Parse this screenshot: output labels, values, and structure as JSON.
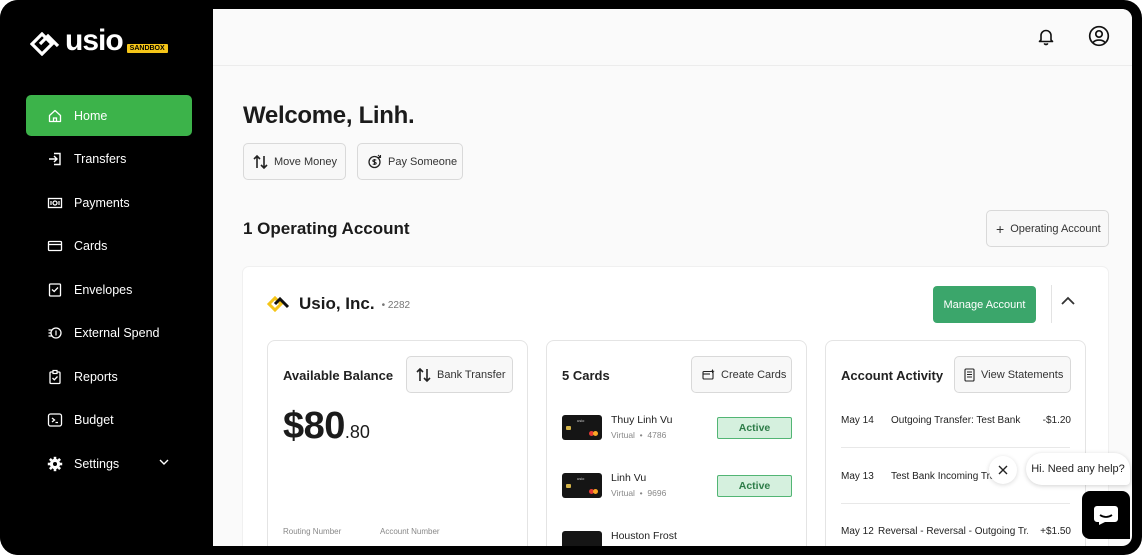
{
  "brand": {
    "name": "usio",
    "env_badge": "SANDBOX",
    "accent": "#3cb34a"
  },
  "sidebar": {
    "items": [
      {
        "label": "Home",
        "icon": "home-icon",
        "active": true
      },
      {
        "label": "Transfers",
        "icon": "transfer-in-icon",
        "active": false
      },
      {
        "label": "Payments",
        "icon": "cash-icon",
        "active": false
      },
      {
        "label": "Cards",
        "icon": "credit-card-icon",
        "active": false
      },
      {
        "label": "Envelopes",
        "icon": "envelope-icon",
        "active": false
      },
      {
        "label": "External Spend",
        "icon": "external-spend-icon",
        "active": false
      },
      {
        "label": "Reports",
        "icon": "clipboard-icon",
        "active": false
      },
      {
        "label": "Budget",
        "icon": "budget-icon",
        "active": false
      }
    ],
    "settings_label": "Settings"
  },
  "header": {
    "greeting": "Welcome, Linh."
  },
  "actions": {
    "move_money": "Move Money",
    "pay_someone": "Pay Someone"
  },
  "accounts": {
    "title": "1 Operating Account",
    "add_label": "Operating Account"
  },
  "account": {
    "company": "Usio, Inc.",
    "number": "• 2282",
    "manage_label": "Manage Account",
    "balance": {
      "title": "Available Balance",
      "transfer_label": "Bank Transfer",
      "dollars": "$80",
      "cents": ".80",
      "routing_label": "Routing Number",
      "account_label": "Account Number"
    },
    "cards": {
      "title": "5 Cards",
      "create_label": "Create Cards",
      "items": [
        {
          "name": "Thuy Linh Vu",
          "type": "Virtual",
          "last4": "4786",
          "status": "Active"
        },
        {
          "name": "Linh Vu",
          "type": "Virtual",
          "last4": "9696",
          "status": "Active"
        },
        {
          "name": "Houston Frost",
          "type": "",
          "last4": "",
          "status": ""
        }
      ]
    },
    "activity": {
      "title": "Account Activity",
      "statements_label": "View Statements",
      "rows": [
        {
          "date": "May 14",
          "desc": "Outgoing Transfer: Test Bank",
          "amount": "-$1.20"
        },
        {
          "date": "May 13",
          "desc": "Test Bank Incoming Tra",
          "amount": ""
        },
        {
          "date": "May 12",
          "desc": "Reversal - Reversal - Outgoing Tr...",
          "amount": "+$1.50"
        }
      ]
    }
  },
  "chat": {
    "prompt": "Hi. Need any help?"
  }
}
